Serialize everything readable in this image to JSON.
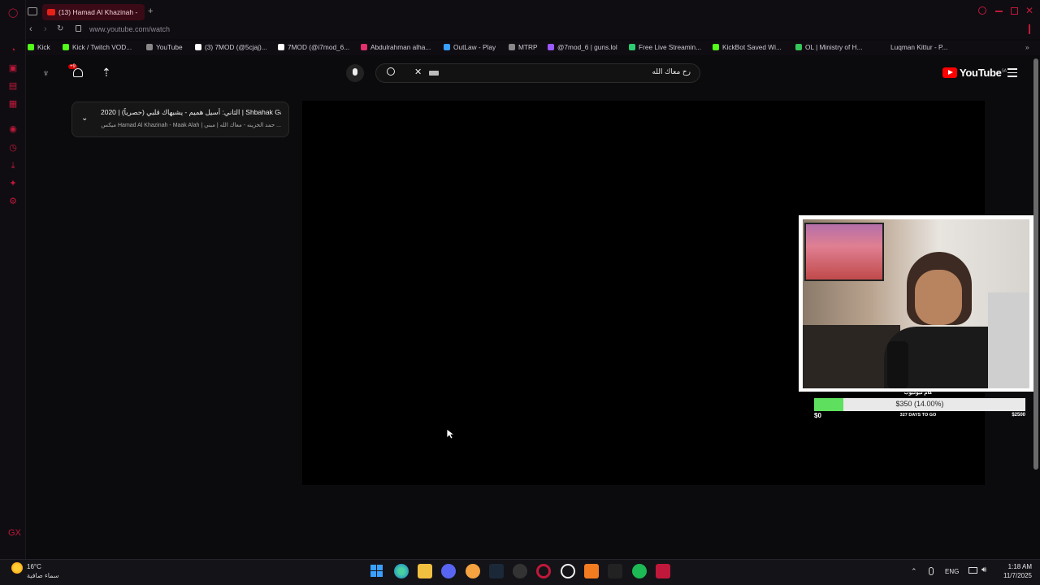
{
  "browser": {
    "active_tab_title": "(13) Hamad Al Khazinah -",
    "url": "www.youtube.com/watch",
    "bookmarks": [
      {
        "label": "Kick",
        "color": "#53fc18"
      },
      {
        "label": "Kick / Twitch VOD...",
        "color": "#53fc18"
      },
      {
        "label": "YouTube",
        "color": "#888888"
      },
      {
        "label": "(3) 7MOD (@5cjaj)...",
        "color": "#ffffff"
      },
      {
        "label": "7MOD (@i7mod_6...",
        "color": "#ffffff"
      },
      {
        "label": "Abdulrahman alha...",
        "color": "#e1306c"
      },
      {
        "label": "OutLaw - Play",
        "color": "#3aa0ff"
      },
      {
        "label": "MTRP",
        "color": "#888888"
      },
      {
        "label": "@7mod_6 | guns.lol",
        "color": "#9b59ff"
      },
      {
        "label": "Free Live Streamin...",
        "color": "#2ecc71"
      },
      {
        "label": "KickBot Saved Wi...",
        "color": "#53fc18"
      },
      {
        "label": "OL | Ministry of H...",
        "color": "#35c759"
      },
      {
        "label": "Luqman Kittur - P...",
        "color": "#888888"
      }
    ]
  },
  "youtube": {
    "notification_count": "+9",
    "search_query": "رح معاك الله",
    "logo_text": "YouTube",
    "logo_region": "SA",
    "playlist": {
      "title": "الثاني: أسيل هميم - يشبهاك قلبي (حصرياً) | 2020 | Shbahak Galbi...",
      "subtitle": "ميكس Hamad Al Khazinah - Maak Alah | حمد الخزينه - معاك الله | مبني ..."
    }
  },
  "stream_overlay": {
    "goal_title": "كام تيوتيوب",
    "goal_progress_text": "$350 (14.00%)",
    "goal_progress_fraction": 0.14,
    "goal_min": "$0",
    "goal_days": "327 DAYS TO GO",
    "goal_max": "$2500"
  },
  "taskbar": {
    "weather_temp": "16°C",
    "weather_desc": "سماء صافية",
    "language": "ENG",
    "time": "1:18 AM",
    "date": "11/7/2025"
  }
}
